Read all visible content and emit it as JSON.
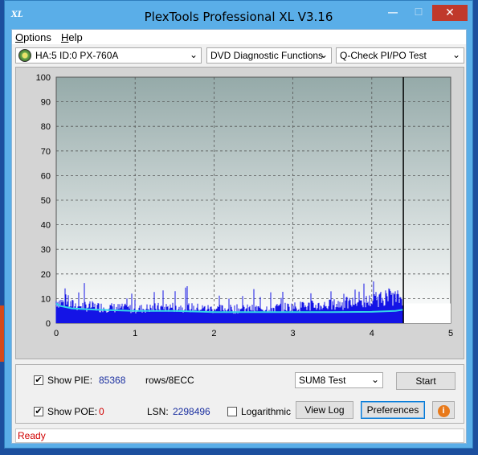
{
  "window": {
    "title": "PlexTools Professional XL V3.16",
    "icon_text": "XL",
    "controls": {
      "minimize": "—",
      "maximize": "☐",
      "close": "✕"
    }
  },
  "menu": {
    "options_u": "O",
    "options_rest": "ptions",
    "help_u": "H",
    "help_rest": "elp"
  },
  "toolbar": {
    "drive": "HA:5 ID:0  PX-760A",
    "function": "DVD Diagnostic Functions",
    "test": "Q-Check PI/PO Test",
    "dropdown_arrow": "⌄"
  },
  "chart_data": {
    "type": "bar",
    "x_ticks": [
      "0",
      "1",
      "2",
      "3",
      "4",
      "5"
    ],
    "y_ticks": [
      "0",
      "10",
      "20",
      "30",
      "40",
      "50",
      "60",
      "70",
      "80",
      "90",
      "100"
    ],
    "xlim": [
      0,
      5
    ],
    "ylim": [
      0,
      100
    ],
    "grid": true,
    "scan_end_x": 4.4,
    "series": [
      {
        "values_x": [
          0,
          0.2,
          0.5,
          1.0,
          1.5,
          2.0,
          2.5,
          3.0,
          3.5,
          4.0,
          4.2,
          4.4
        ],
        "values_y": [
          11,
          9,
          8,
          7,
          8,
          7,
          7,
          8,
          9,
          11,
          13,
          12
        ],
        "color": "#1414e6"
      },
      {
        "values_x": [
          0,
          0.05,
          0.2,
          0.5,
          1.0,
          1.5,
          2.0,
          2.5,
          3.0,
          3.5,
          4.0,
          4.3,
          4.4
        ],
        "values_y": [
          8,
          7,
          6,
          5.5,
          5,
          5,
          4.5,
          4.5,
          4.5,
          4.5,
          4.6,
          5,
          5.5
        ],
        "color": "#33d6e8"
      }
    ],
    "colors": {
      "plot_top": "#95aaa9",
      "plot_bottom": "#ffffff",
      "grid": "#555555",
      "end_line": "#000000"
    }
  },
  "stats": {
    "show_pie_label": "Show PIE:",
    "pie_value": "85368",
    "pie_unit": "rows/8ECC",
    "show_poe_label": "Show POE:",
    "poe_value": "0",
    "lsn_label": "LSN:",
    "lsn_value": "2298496",
    "logarithmic_label": "Logarithmic",
    "show_pie_checked": true,
    "show_poe_checked": true,
    "logarithmic_checked": false
  },
  "controls": {
    "sum_select": "SUM8 Test",
    "start_label": "Start",
    "view_log_label": "View Log",
    "preferences_label": "Preferences",
    "info_label": "i"
  },
  "status": {
    "text": "Ready"
  },
  "checkmark": "✔"
}
